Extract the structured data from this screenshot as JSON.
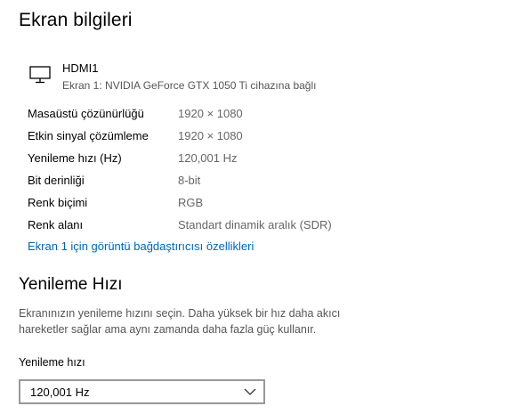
{
  "page_title": "Ekran bilgileri",
  "monitor": {
    "icon": "monitor-icon",
    "name": "HDMI1",
    "description": "Ekran 1: NVIDIA GeForce GTX 1050 Ti cihazına bağlı"
  },
  "properties": [
    {
      "label": "Masaüstü çözünürlüğü",
      "value": "1920 × 1080"
    },
    {
      "label": "Etkin sinyal çözümleme",
      "value": "1920 × 1080"
    },
    {
      "label": "Yenileme hızı (Hz)",
      "value": "120,001 Hz"
    },
    {
      "label": "Bit derinliği",
      "value": "8-bit"
    },
    {
      "label": "Renk biçimi",
      "value": "RGB"
    },
    {
      "label": "Renk alanı",
      "value": "Standart dinamik aralık (SDR)"
    }
  ],
  "adapter_link": "Ekran 1 için görüntü bağdaştırıcısı özellikleri",
  "refresh_section": {
    "title": "Yenileme Hızı",
    "description_line1": "Ekranınızın yenileme hızını seçin. Daha yüksek bir hız daha akıcı",
    "description_line2": "hareketler sağlar ama aynı zamanda daha fazla güç kullanır.",
    "field_label": "Yenileme hızı",
    "selected_value": "120,001 Hz",
    "chevron_icon": "chevron-down-icon"
  },
  "colors": {
    "link": "#0066b4",
    "secondary_text": "#666666",
    "dropdown_border": "#999999"
  }
}
